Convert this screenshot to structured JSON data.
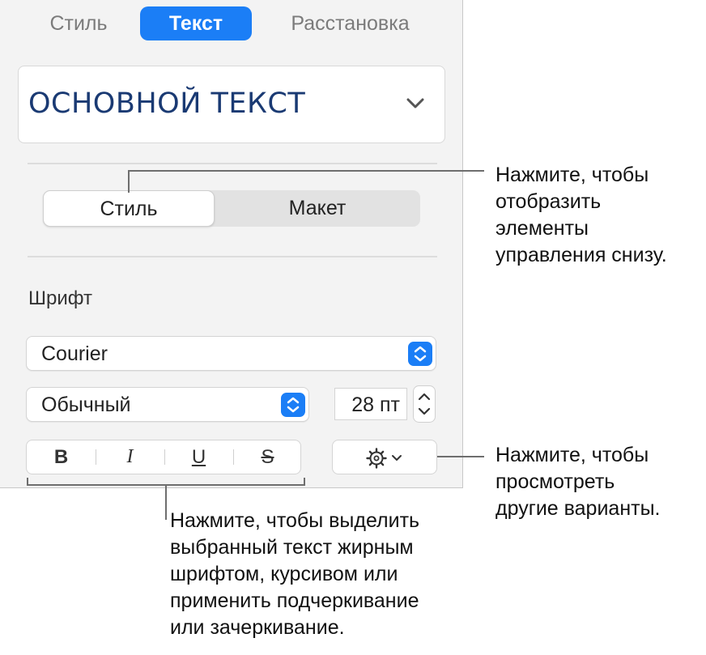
{
  "tabs": [
    {
      "label": "Стиль",
      "active": false
    },
    {
      "label": "Текст",
      "active": true
    },
    {
      "label": "Расстановка",
      "active": false
    }
  ],
  "paragraph_style": {
    "value": "ОСНОВНОЙ ТЕКСТ",
    "icon": "chevron-down-icon"
  },
  "segmented": [
    {
      "label": "Стиль",
      "selected": true
    },
    {
      "label": "Макет",
      "selected": false
    }
  ],
  "font_section": {
    "label": "Шрифт",
    "family": "Courier",
    "typeface": "Обычный",
    "size": "28 пт"
  },
  "format_buttons": [
    {
      "label": "B",
      "name": "bold"
    },
    {
      "label": "I",
      "name": "italic"
    },
    {
      "label": "U",
      "name": "underline"
    },
    {
      "label": "S",
      "name": "strikethrough"
    }
  ],
  "options_button": {
    "icon": "gear-icon"
  },
  "callouts": {
    "segment": [
      "Нажмите, чтобы",
      "отобразить",
      "элементы",
      "управления снизу."
    ],
    "options": [
      "Нажмите, чтобы",
      "просмотреть",
      "другие варианты."
    ],
    "format": [
      "Нажмите, чтобы выделить",
      "выбранный текст жирным",
      "шрифтом, курсивом или",
      "применить подчеркивание",
      "или зачеркивание."
    ]
  },
  "colors": {
    "accent": "#1b7ef6",
    "panel": "#f3f3f3",
    "style_text": "#1a3a73"
  }
}
